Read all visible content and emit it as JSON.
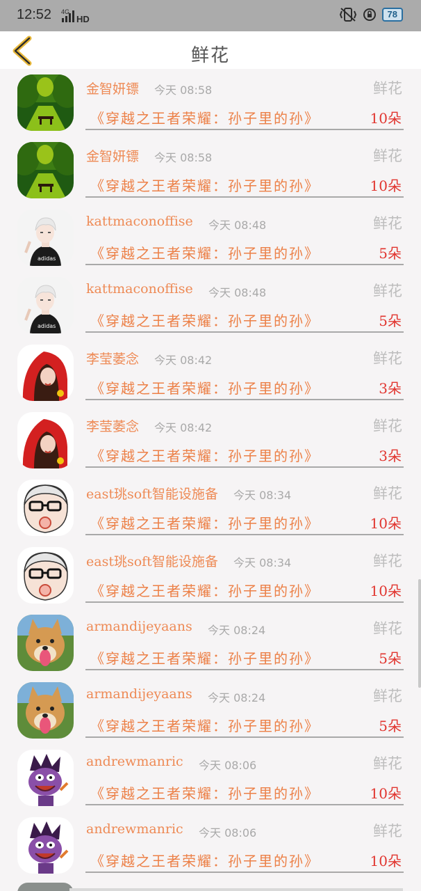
{
  "status_bar": {
    "time": "12:52",
    "network": "4G",
    "hd": "HD",
    "battery": "78"
  },
  "header": {
    "title": "鲜花"
  },
  "colors": {
    "name": "#ee8a55",
    "book": "#ec8047",
    "count": "#e1352f",
    "meta": "#a9a9a9",
    "accent_back": "#e8b83a"
  },
  "list": [
    {
      "name": "金智妍镖",
      "time": "今天 08:58",
      "type": "鲜花",
      "book": "《穿越之王者荣耀：孙子里的孙》",
      "count": "10朵",
      "avatar": "forest-avatar"
    },
    {
      "name": "金智妍镖",
      "time": "今天 08:58",
      "type": "鲜花",
      "book": "《穿越之王者荣耀：孙子里的孙》",
      "count": "10朵",
      "avatar": "forest-avatar"
    },
    {
      "name": "kattmaconoffise",
      "time": "今天 08:48",
      "type": "鲜花",
      "book": "《穿越之王者荣耀：孙子里的孙》",
      "count": "5朵",
      "avatar": "anime-boy-avatar"
    },
    {
      "name": "kattmaconoffise",
      "time": "今天 08:48",
      "type": "鲜花",
      "book": "《穿越之王者荣耀：孙子里的孙》",
      "count": "5朵",
      "avatar": "anime-boy-avatar"
    },
    {
      "name": "李莹萎念",
      "time": "今天 08:42",
      "type": "鲜花",
      "book": "《穿越之王者荣耀：孙子里的孙》",
      "count": "3朵",
      "avatar": "red-hood-avatar"
    },
    {
      "name": "李莹萎念",
      "time": "今天 08:42",
      "type": "鲜花",
      "book": "《穿越之王者荣耀：孙子里的孙》",
      "count": "3朵",
      "avatar": "red-hood-avatar"
    },
    {
      "name": "east珧soft智能设施备",
      "time": "今天 08:34",
      "type": "鲜花",
      "book": "《穿越之王者荣耀：孙子里的孙》",
      "count": "10朵",
      "avatar": "glasses-man-avatar"
    },
    {
      "name": "east珧soft智能设施备",
      "time": "今天 08:34",
      "type": "鲜花",
      "book": "《穿越之王者荣耀：孙子里的孙》",
      "count": "10朵",
      "avatar": "glasses-man-avatar"
    },
    {
      "name": "armandijeyaans",
      "time": "今天 08:24",
      "type": "鲜花",
      "book": "《穿越之王者荣耀：孙子里的孙》",
      "count": "5朵",
      "avatar": "shiba-dog-avatar"
    },
    {
      "name": "armandijeyaans",
      "time": "今天 08:24",
      "type": "鲜花",
      "book": "《穿越之王者荣耀：孙子里的孙》",
      "count": "5朵",
      "avatar": "shiba-dog-avatar"
    },
    {
      "name": "andrewmanric",
      "time": "今天 08:06",
      "type": "鲜花",
      "book": "《穿越之王者荣耀：孙子里的孙》",
      "count": "10朵",
      "avatar": "purple-monster-avatar"
    },
    {
      "name": "andrewmanric",
      "time": "今天 08:06",
      "type": "鲜花",
      "book": "《穿越之王者荣耀：孙子里的孙》",
      "count": "10朵",
      "avatar": "purple-monster-avatar"
    }
  ]
}
